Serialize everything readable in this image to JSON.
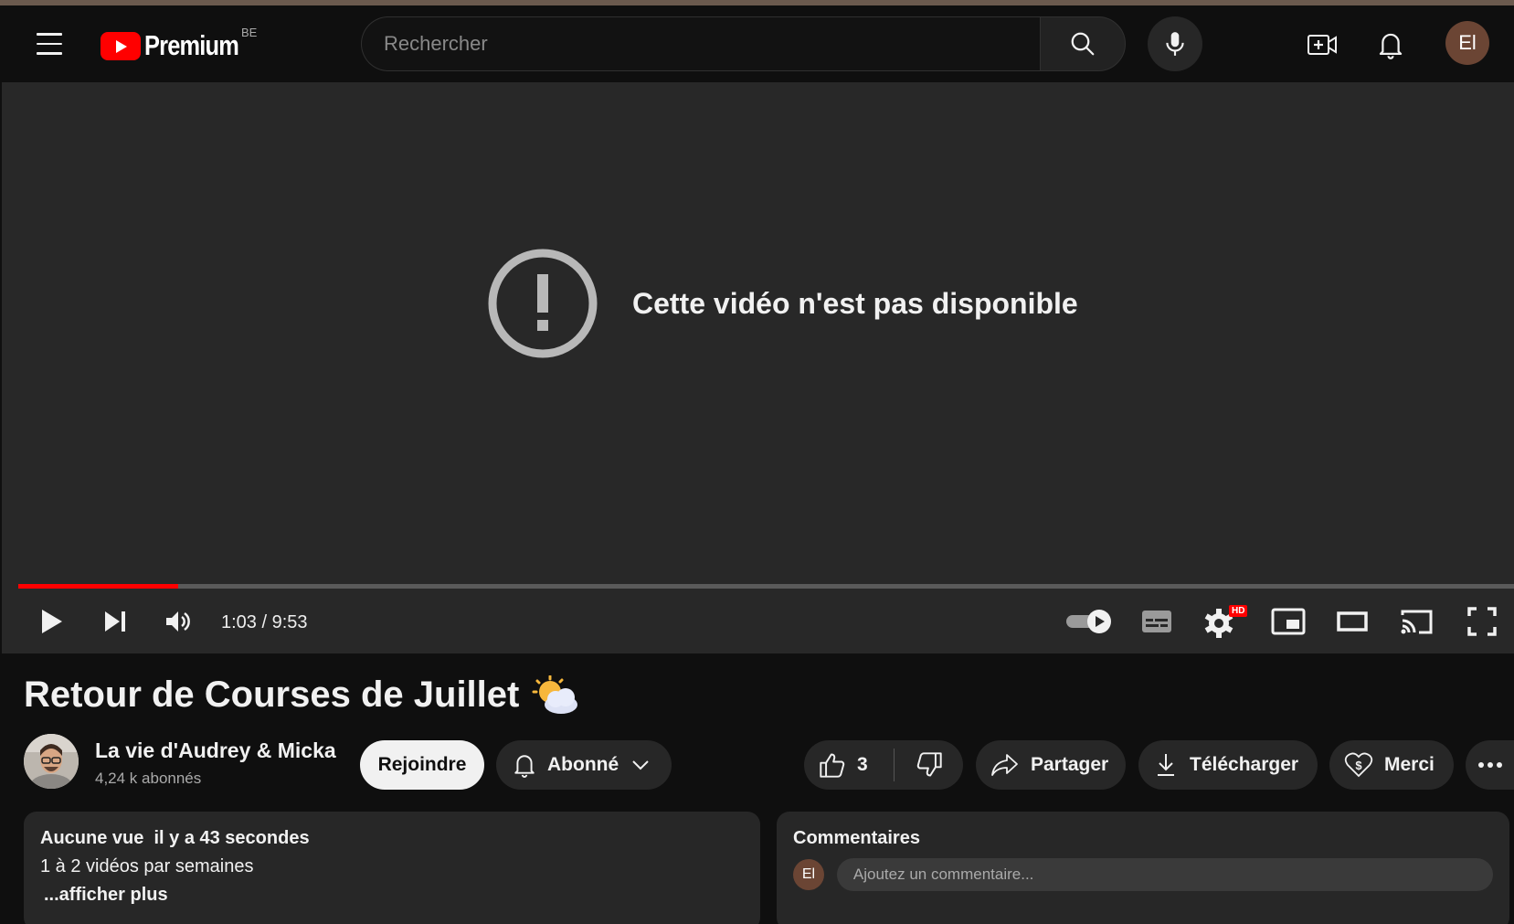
{
  "header": {
    "logo_text": "Premium",
    "country_code": "BE",
    "search_placeholder": "Rechercher",
    "avatar_initials": "El"
  },
  "player": {
    "error_message": "Cette vidéo n'est pas disponible",
    "time_display": "1:03 / 9:53",
    "progress_fraction": 0.107,
    "hd_badge": "HD",
    "accent_color": "#ff0000"
  },
  "video": {
    "title": "Retour de Courses de Juillet",
    "title_emoji": "sun-behind-cloud-icon"
  },
  "channel": {
    "name": "La vie d'Audrey & Micka",
    "subscribers": "4,24 k abonnés"
  },
  "actions": {
    "join_label": "Rejoindre",
    "subscribed_label": "Abonné",
    "like_count": "3",
    "share_label": "Partager",
    "download_label": "Télécharger",
    "thanks_label": "Merci"
  },
  "description": {
    "stats": "Aucune vue  il y a 43 secondes",
    "text": "1 à 2 vidéos par semaines",
    "more_label": "...afficher plus"
  },
  "comments": {
    "title": "Commentaires",
    "avatar_initials": "El",
    "placeholder": "Ajoutez un commentaire..."
  }
}
